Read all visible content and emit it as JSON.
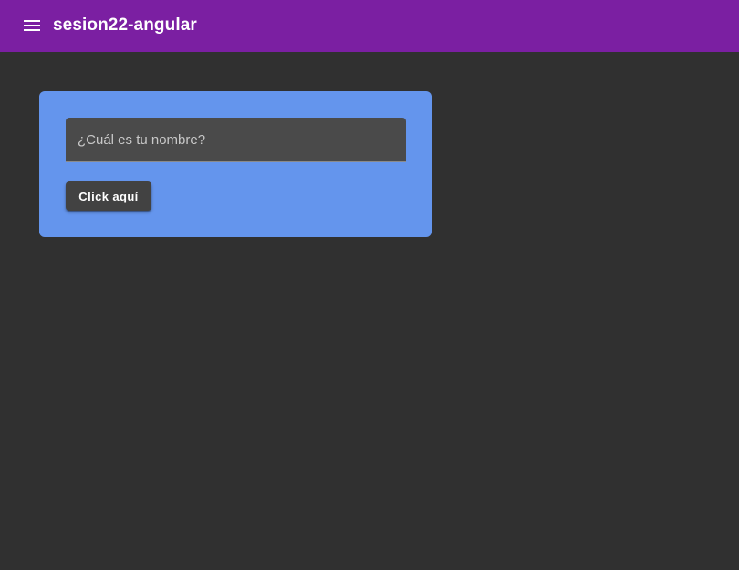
{
  "toolbar": {
    "menu_icon": "menu-icon",
    "title": "sesion22-angular",
    "background_color": "#7b1fa2"
  },
  "card": {
    "background_color": "#6495ed",
    "name_input": {
      "placeholder": "¿Cuál es tu nombre?",
      "value": ""
    },
    "submit_label": "Click aquí"
  },
  "page": {
    "background_color": "#303030"
  }
}
